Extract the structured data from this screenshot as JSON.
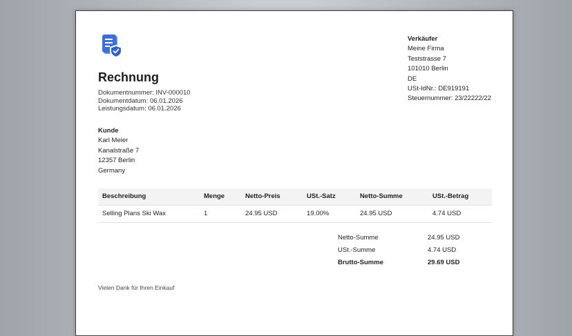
{
  "document": {
    "title": "Rechnung",
    "number_line": "Dokumentnummer: INV-000010",
    "date_line": "Dokumentdatum: 06.01.2026",
    "service_date_line": "Leistungsdatum: 06.01.2026"
  },
  "logo": {
    "icon": "document-shield-icon",
    "color": "#3b6fd6"
  },
  "seller": {
    "heading": "Verkäufer",
    "name": "Meine Firma",
    "street": "Teststrasse 7",
    "city": "101010 Berlin",
    "country": "DE",
    "vat_id": "USt-IdNr.: DE919191",
    "tax_number": "Steuernummer: 23/22222/22"
  },
  "customer": {
    "heading": "Kunde",
    "name": "Karl Meier",
    "street": "Kanalstraße 7",
    "city": "12357 Berlin",
    "country": "Germany"
  },
  "items": {
    "headers": [
      "Beschreibung",
      "Menge",
      "Netto-Preis",
      "USt.-Satz",
      "Netto-Summe",
      "USt.-Betrag"
    ],
    "rows": [
      [
        "Selling Plans Ski Wax",
        "1",
        "24.95 USD",
        "19.00%",
        "24.95 USD",
        "4.74 USD"
      ]
    ]
  },
  "totals": {
    "net_label": "Netto-Summe",
    "net_value": "24.95 USD",
    "vat_label": "USt.-Summe",
    "vat_value": "4.74 USD",
    "gross_label": "Brutto-Summe",
    "gross_value": "29.69 USD"
  },
  "footer": {
    "text": "Vielen Dank für Ihren Einkauf"
  }
}
